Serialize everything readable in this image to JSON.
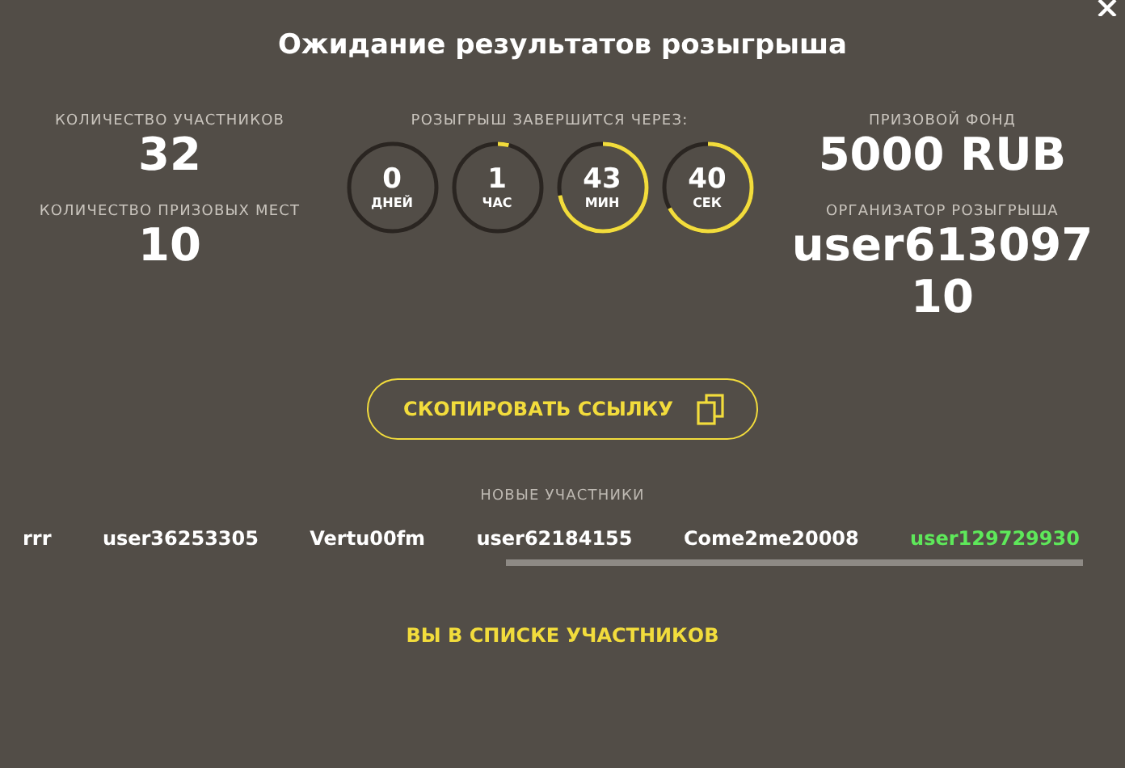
{
  "title": "Ожидание результатов розыгрыша",
  "participants_count": {
    "label": "КОЛИЧЕСТВО УЧАСТНИКОВ",
    "value": "32"
  },
  "prize_places": {
    "label": "КОЛИЧЕСТВО ПРИЗОВЫХ МЕСТ",
    "value": "10"
  },
  "countdown": {
    "label": "РОЗЫГРЫШ ЗАВЕРШИТСЯ ЧЕРЕЗ:",
    "units": [
      {
        "value": "0",
        "unit": "ДНЕЙ",
        "level": 0
      },
      {
        "value": "1",
        "unit": "ЧАС",
        "level": 0.04
      },
      {
        "value": "43",
        "unit": "МИН",
        "level": 0.72
      },
      {
        "value": "40",
        "unit": "СЕК",
        "level": 0.67
      }
    ]
  },
  "prize_fund": {
    "label": "ПРИЗОВОЙ ФОНД",
    "value": "5000 RUB"
  },
  "organizer": {
    "label": "ОРГАНИЗАТОР РОЗЫГРЫША",
    "value": "user61309710"
  },
  "copy_button": "СКОПИРОВАТЬ ССЫЛКУ",
  "new_participants": {
    "label": "НОВЫЕ УЧАСТНИКИ",
    "items": [
      {
        "name": "rrr",
        "highlighted": false
      },
      {
        "name": "user36253305",
        "highlighted": false
      },
      {
        "name": "Vertu00fm",
        "highlighted": false
      },
      {
        "name": "user62184155",
        "highlighted": false
      },
      {
        "name": "Come2me20008",
        "highlighted": false
      },
      {
        "name": "user129729930",
        "highlighted": true
      }
    ]
  },
  "status": "ВЫ В СПИСКЕ УЧАСТНИКОВ"
}
